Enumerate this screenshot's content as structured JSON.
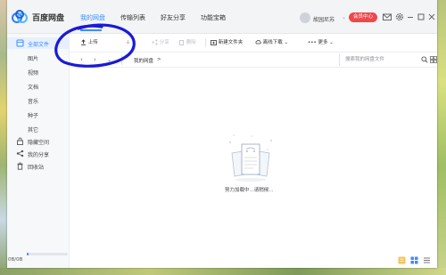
{
  "app": {
    "name": "百度网盘"
  },
  "tabs": [
    {
      "label": "我的网盘",
      "active": true
    },
    {
      "label": "传输列表",
      "active": false
    },
    {
      "label": "好友分享",
      "active": false
    },
    {
      "label": "功能宝箱",
      "active": false
    }
  ],
  "user": {
    "name": "故园尼苏",
    "vip_label": "会员中心"
  },
  "toolbar": {
    "upload": "上传",
    "share": "分享",
    "delete": "删除",
    "new_folder": "新建文件夹",
    "offline_download": "离线下载",
    "more": "更多"
  },
  "breadcrumb": {
    "root": "我的网盘",
    "separator": ">"
  },
  "search": {
    "placeholder": "搜索我的网盘文件"
  },
  "sidebar": {
    "items": [
      {
        "label": "全部文件",
        "icon": "folder-icon",
        "active": true
      },
      {
        "label": "图片"
      },
      {
        "label": "视频"
      },
      {
        "label": "文档"
      },
      {
        "label": "音乐"
      },
      {
        "label": "种子"
      },
      {
        "label": "其它"
      },
      {
        "label": "隐藏空间",
        "icon": "lock-icon"
      },
      {
        "label": "我的分享",
        "icon": "share-icon"
      },
      {
        "label": "回收站",
        "icon": "trash-icon"
      }
    ],
    "storage": {
      "text": "0B/0B",
      "fill": 0.05
    }
  },
  "main": {
    "loading_text": "努力加载中...请稍候..."
  },
  "colors": {
    "accent": "#3b8cff",
    "vip": "#f0484a",
    "annotation": "#1a1ad6"
  }
}
